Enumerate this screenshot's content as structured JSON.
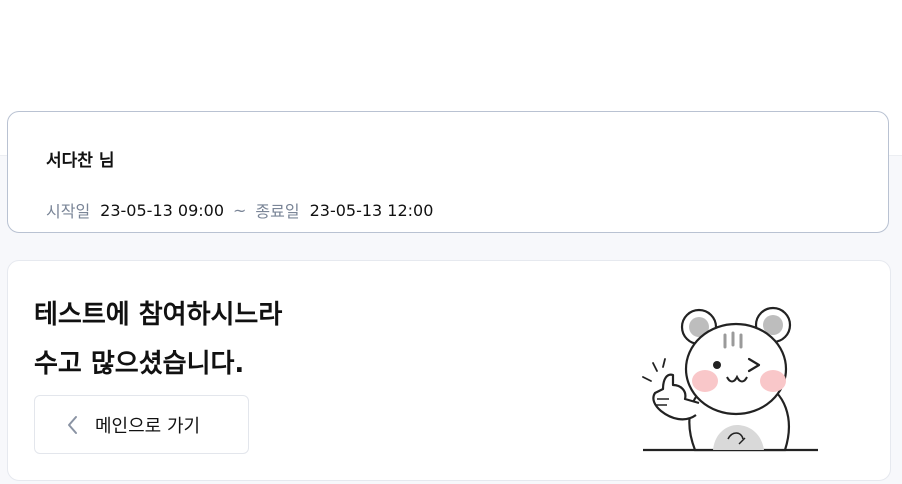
{
  "user": {
    "name": "서다찬 님"
  },
  "schedule": {
    "start_label": "시작일",
    "start_value": "23-05-13 09:00",
    "separator": "~",
    "end_label": "종료일",
    "end_value": "23-05-13 12:00"
  },
  "completion": {
    "line1": "테스트에 참여하시느라",
    "line2": "수고 많으셨습니다.",
    "back_button_label": "메인으로 가기",
    "back_icon": "chevron-left-icon",
    "illustration": "hamster-thumbs-up-illustration"
  },
  "colors": {
    "accent_border": "#b9c2d2",
    "muted_text": "#7a8597",
    "cheek": "#f9c7c9"
  }
}
